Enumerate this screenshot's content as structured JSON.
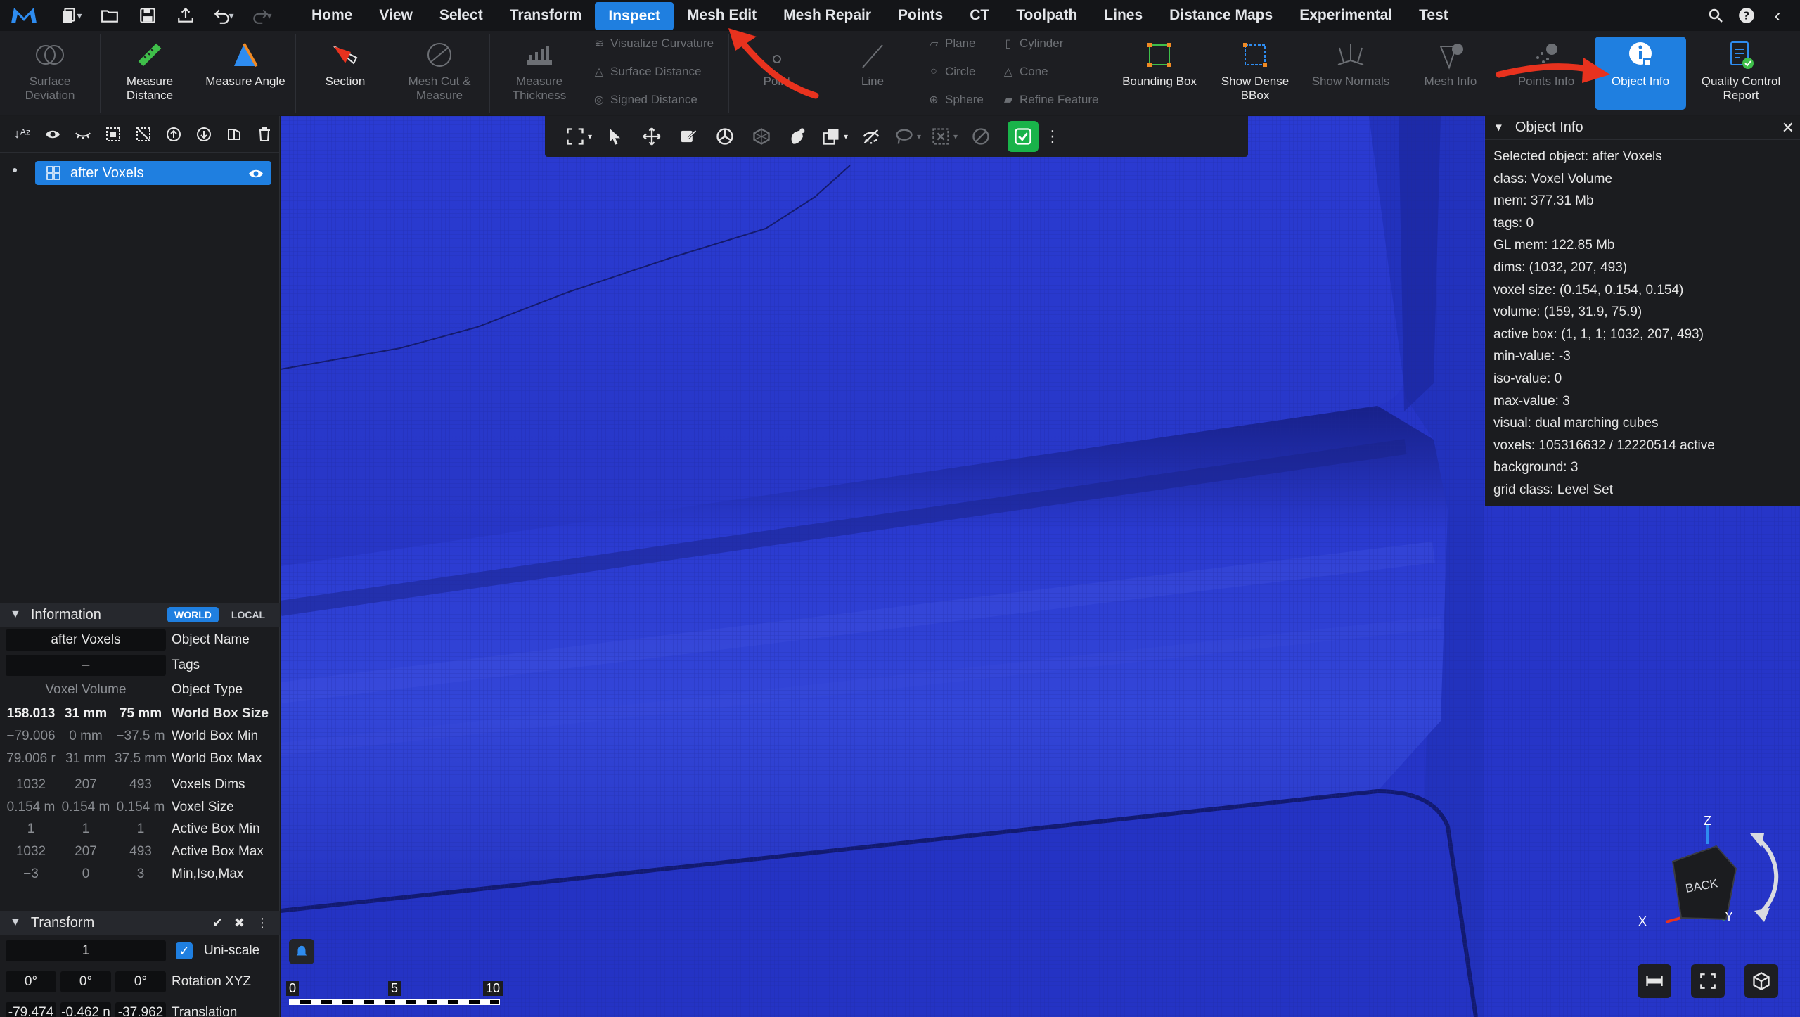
{
  "menubar": {
    "tabs": [
      "Home",
      "View",
      "Select",
      "Transform",
      "Inspect",
      "Mesh Edit",
      "Mesh Repair",
      "Points",
      "CT",
      "Toolpath",
      "Lines",
      "Distance Maps",
      "Experimental",
      "Test"
    ],
    "active_tab": "Inspect"
  },
  "ribbon": {
    "surface_deviation": "Surface Deviation",
    "measure_distance": "Measure Distance",
    "measure_angle": "Measure Angle",
    "section": "Section",
    "mesh_cut_measure": "Mesh Cut & Measure",
    "measure_thickness": "Measure Thickness",
    "visualize_curvature": "Visualize Curvature",
    "surface_distance": "Surface Distance",
    "signed_distance": "Signed Distance",
    "point": "Point",
    "line": "Line",
    "plane": "Plane",
    "circle": "Circle",
    "sphere": "Sphere",
    "cylinder": "Cylinder",
    "cone": "Cone",
    "refine_feature": "Refine Feature",
    "bounding_box": "Bounding Box",
    "show_dense_bbox": "Show Dense BBox",
    "show_normals": "Show Normals",
    "mesh_info": "Mesh Info",
    "points_info": "Points Info",
    "object_info": "Object Info",
    "quality_control_report": "Quality Control Report"
  },
  "scene": {
    "item_name": "after Voxels"
  },
  "information": {
    "title": "Information",
    "world": "WORLD",
    "local": "LOCAL",
    "object_name_value": "after Voxels",
    "object_name_label": "Object Name",
    "tags_value": "–",
    "tags_label": "Tags",
    "object_type_value": "Voxel Volume",
    "object_type_label": "Object Type",
    "world_box_size": [
      "158.013",
      "31 mm",
      "75 mm"
    ],
    "world_box_size_label": "World Box Size",
    "world_box_min": [
      "−79.006",
      "0 mm",
      "−37.5 m"
    ],
    "world_box_min_label": "World Box Min",
    "world_box_max": [
      "79.006 r",
      "31 mm",
      "37.5 mm"
    ],
    "world_box_max_label": "World Box Max",
    "voxels_dims": [
      "1032",
      "207",
      "493"
    ],
    "voxels_dims_label": "Voxels Dims",
    "voxel_size": [
      "0.154 m",
      "0.154 m",
      "0.154 m"
    ],
    "voxel_size_label": "Voxel Size",
    "active_box_min": [
      "1",
      "1",
      "1"
    ],
    "active_box_min_label": "Active Box Min",
    "active_box_max": [
      "1032",
      "207",
      "493"
    ],
    "active_box_max_label": "Active Box Max",
    "min_iso_max": [
      "−3",
      "0",
      "3"
    ],
    "min_iso_max_label": "Min,Iso,Max"
  },
  "transform": {
    "title": "Transform",
    "scale_value": "1",
    "uniscale_label": "Uni-scale",
    "rotation": [
      "0°",
      "0°",
      "0°"
    ],
    "rotation_label": "Rotation XYZ",
    "translation": [
      "-79.474",
      "-0.462 n",
      "-37.962"
    ],
    "translation_label": "Translation"
  },
  "object_info": {
    "title": "Object Info",
    "lines": [
      "Selected object: after Voxels",
      "class: Voxel Volume",
      "mem: 377.31 Mb",
      "tags: 0",
      "GL mem: 122.85 Mb",
      "dims: (1032, 207, 493)",
      "voxel size: (0.154, 0.154, 0.154)",
      "volume: (159, 31.9, 75.9)",
      "active box: (1, 1, 1; 1032, 207, 493)",
      "min-value: -3",
      "iso-value: 0",
      "max-value: 3",
      "visual: dual marching cubes",
      "voxels: 105316632 / 12220514 active",
      "background: 3",
      "grid class: Level Set"
    ]
  },
  "scale_bar": {
    "labels": [
      "0",
      "5",
      "10"
    ]
  },
  "view_cube": {
    "face": "BACK",
    "axes": [
      "Z",
      "X",
      "Y"
    ]
  },
  "colors": {
    "accent": "#1f7fe0",
    "model": "#2a36c8",
    "arrow": "#e8321e",
    "ok": "#19b34a"
  }
}
